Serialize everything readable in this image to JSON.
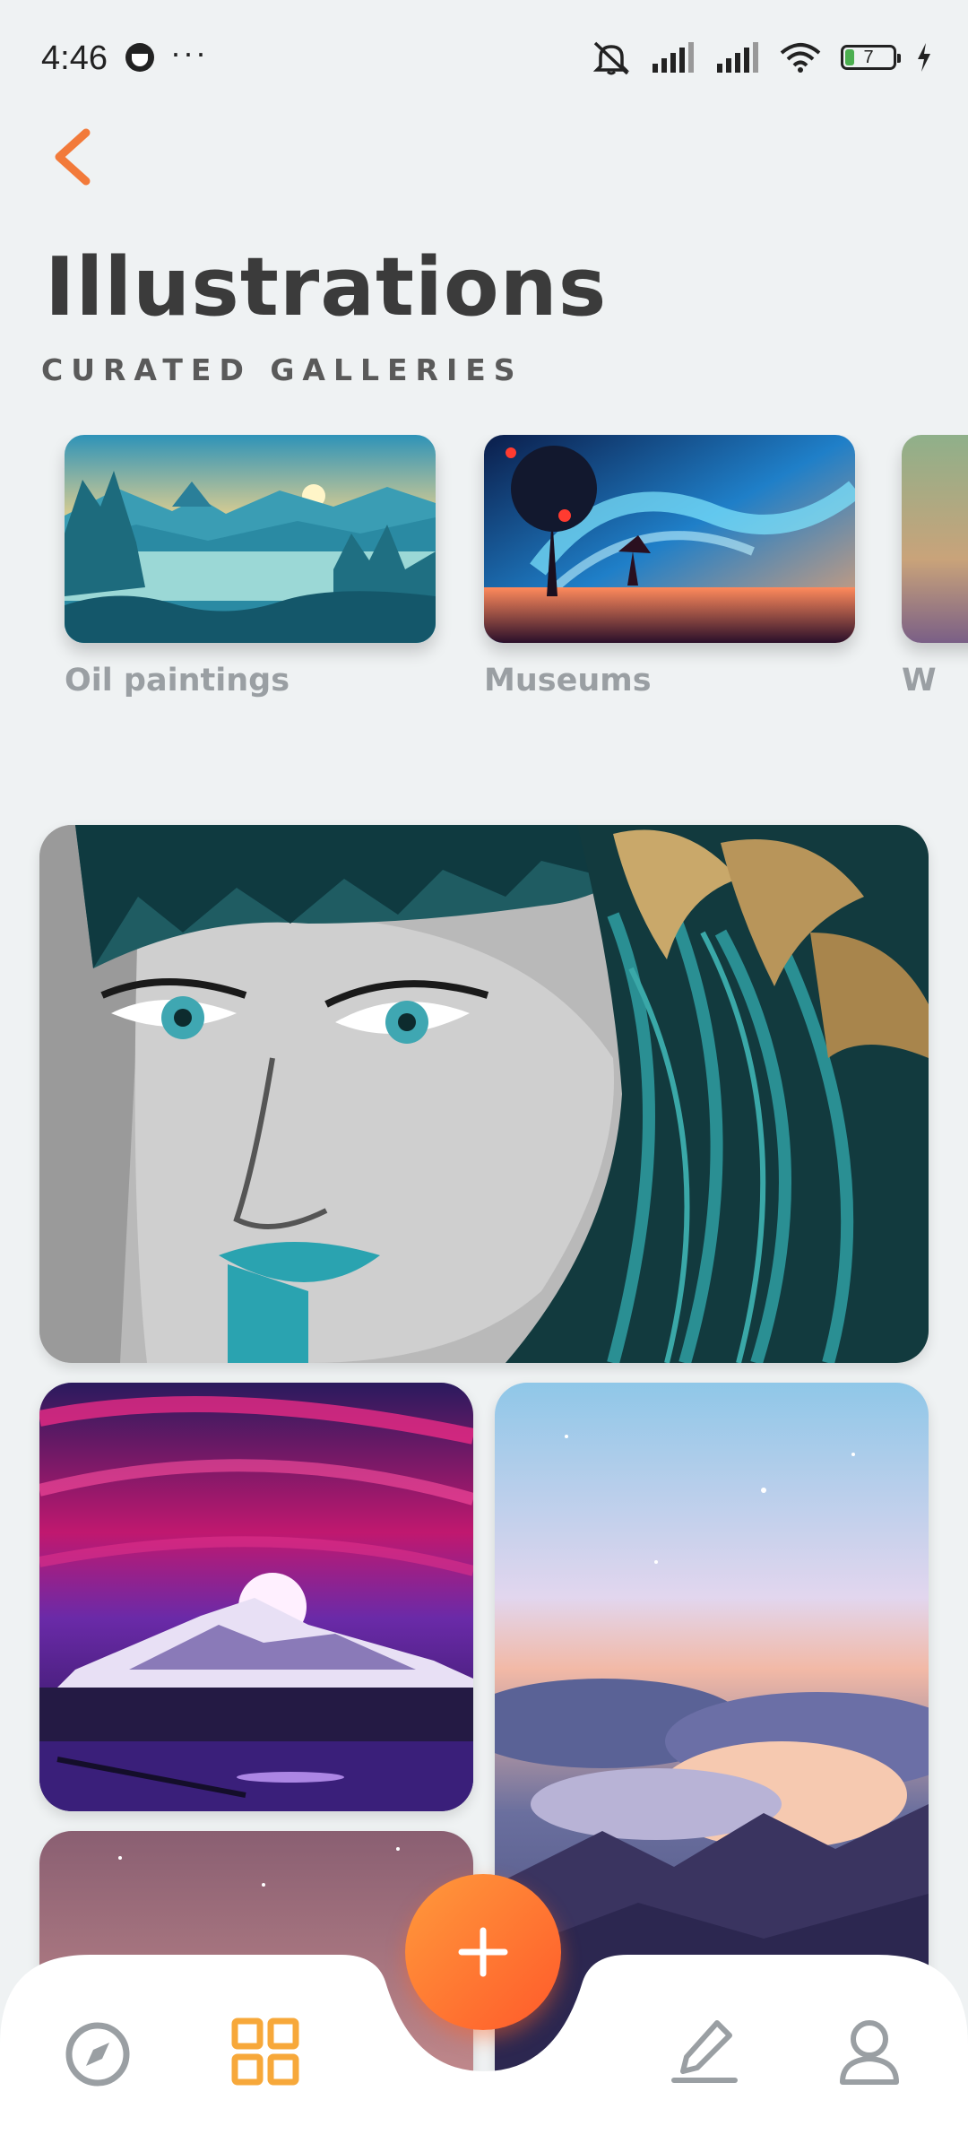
{
  "status_bar": {
    "time": "4:46",
    "battery_level": "7",
    "icons": [
      "face-icon",
      "more-dots-icon",
      "mute-icon",
      "signal-icon",
      "signal-icon",
      "wifi-icon",
      "battery-icon",
      "charging-icon"
    ]
  },
  "header": {
    "back_icon": "chevron-left-icon",
    "title": "Illustrations",
    "subtitle": "CURATED GALLERIES"
  },
  "galleries": [
    {
      "label": "Oil paintings"
    },
    {
      "label": "Museums"
    },
    {
      "label": "W"
    }
  ],
  "bottom_nav": {
    "items": [
      "compass-icon",
      "grid-icon",
      "add-icon",
      "pen-icon",
      "profile-icon"
    ],
    "active": "grid-icon"
  },
  "colors": {
    "accent": "#ff6a2b",
    "active_nav": "#f7a83a",
    "inactive_nav": "#9a9fa3",
    "background": "#eff2f3"
  }
}
